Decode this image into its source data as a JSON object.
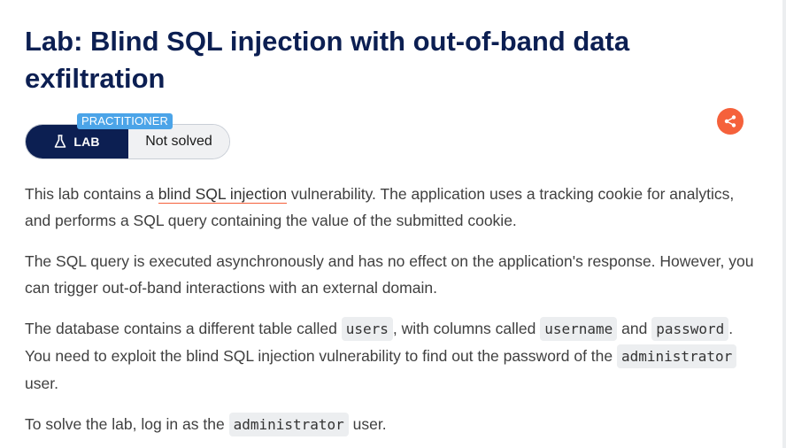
{
  "title": "Lab: Blind SQL injection with out-of-band data exfiltration",
  "badge": {
    "level": "PRACTITIONER",
    "type_label": "LAB",
    "status": "Not solved"
  },
  "share": {
    "icon": "share-icon",
    "color": "#f5613b"
  },
  "description": {
    "p1": {
      "before": "This lab contains a ",
      "link": "blind SQL injection",
      "after": " vulnerability. The application uses a tracking cookie for analytics, and performs a SQL query containing the value of the submitted cookie."
    },
    "p2": "The SQL query is executed asynchronously and has no effect on the application's response. However, you can trigger out-of-band interactions with an external domain.",
    "p3": {
      "t1": "The database contains a different table called ",
      "c1": "users",
      "t2": ", with columns called ",
      "c2": "username",
      "t3": " and ",
      "c3": "password",
      "t4": ". You need to exploit the blind SQL injection vulnerability to find out the password of the ",
      "c4": "administrator",
      "t5": " user."
    },
    "p4": {
      "t1": "To solve the lab, log in as the ",
      "c1": "administrator",
      "t2": " user."
    }
  },
  "colors": {
    "title": "#0c1f52",
    "badge_dark": "#0c1f52",
    "level_tag": "#4ba4e8",
    "accent": "#f5613b"
  }
}
